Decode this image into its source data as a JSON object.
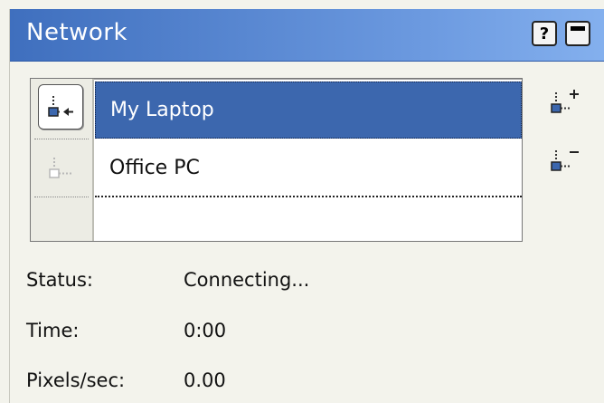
{
  "window": {
    "title": "Network",
    "help_label": "?"
  },
  "list": {
    "items": [
      {
        "label": "My Laptop",
        "selected": true
      },
      {
        "label": "Office PC",
        "selected": false
      },
      {
        "label": "",
        "selected": false
      }
    ]
  },
  "side_actions": [
    {
      "name": "add-host-button",
      "icon": "add-host-icon"
    },
    {
      "name": "remove-host-button",
      "icon": "remove-host-icon"
    }
  ],
  "info": {
    "status_label": "Status:",
    "status_value": "Connecting...",
    "time_label": "Time:",
    "time_value": "0:00",
    "pixels_label": "Pixels/sec:",
    "pixels_value": "0.00"
  },
  "colors": {
    "title_gradient_start": "#3f6fbe",
    "title_gradient_end": "#84b0ee",
    "selection": "#3c67ae",
    "background": "#f3f3ec"
  }
}
